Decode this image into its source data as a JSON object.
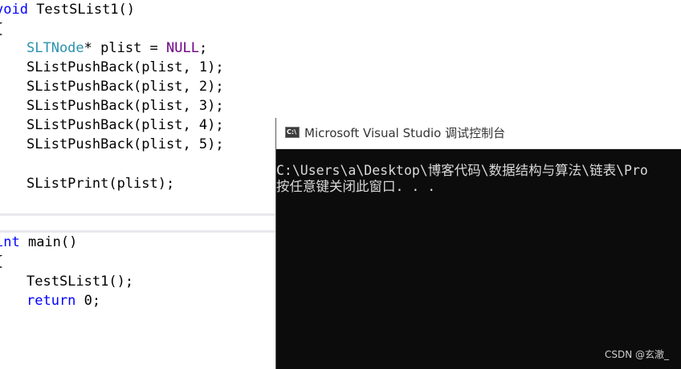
{
  "editor": {
    "code": {
      "func1_sig_type": "void",
      "func1_sig_name": " TestSList1()",
      "open1": "{",
      "decl_type": "SLTNode",
      "decl_rest": "* plist = ",
      "decl_null": "NULL",
      "decl_end": ";",
      "push1": "SListPushBack(plist, 1);",
      "push2": "SListPushBack(plist, 2);",
      "push3": "SListPushBack(plist, 3);",
      "push4": "SListPushBack(plist, 4);",
      "push5": "SListPushBack(plist, 5);",
      "print": "SListPrint(plist);",
      "main_type": "int",
      "main_name": " main()",
      "open2": "{",
      "call": "TestSList1();",
      "return_kw": "return",
      "return_rest": " 0;"
    }
  },
  "console": {
    "icon_label": "C:\\",
    "title": "Microsoft Visual Studio 调试控制台",
    "lines": [
      "C:\\Users\\a\\Desktop\\博客代码\\数据结构与算法\\链表\\Pro",
      "按任意键关闭此窗口. . ."
    ]
  },
  "watermark": "CSDN @玄澈_"
}
